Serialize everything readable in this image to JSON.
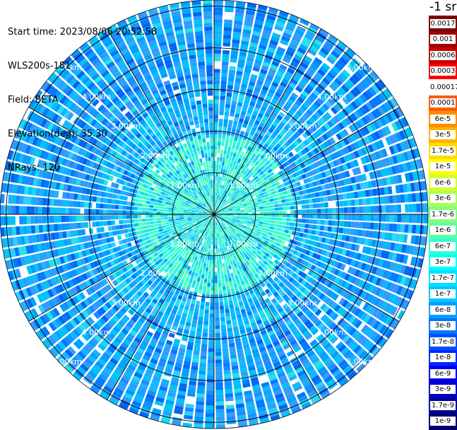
{
  "info": {
    "start_time": "Start time: 2023/08/06 20:52:58",
    "instrument": "WLS200s-181",
    "field": "Field: BETA",
    "elevation": "Elevation(deg): 35.30",
    "nrays": "NRays: 120"
  },
  "colorbar": {
    "title": "-1 sr",
    "labels": [
      "0.0017",
      "0.001",
      "0.0006",
      "0.0003",
      "0.00017",
      "0.0001",
      "6e-5",
      "3e-5",
      "1.7e-5",
      "1e-5",
      "6e-6",
      "3e-6",
      "1.7e-6",
      "1e-6",
      "6e-7",
      "3e-7",
      "1.7e-7",
      "1e-7",
      "6e-8",
      "3e-8",
      "1.7e-8",
      "1e-8",
      "6e-9",
      "3e-9",
      "1.7e-9",
      "1e-9"
    ],
    "colors": [
      "#800000",
      "#a00000",
      "#c80000",
      "#ff0000",
      "#ffffff",
      "#ff5a00",
      "#ff8c00",
      "#ffb400",
      "#ffdc00",
      "#ffff00",
      "#d2ff2d",
      "#aaff55",
      "#82ff7d",
      "#5affa5",
      "#32ffd2",
      "#00ffff",
      "#00e1ff",
      "#00c8ff",
      "#00a0ff",
      "#0078ff",
      "#0050ff",
      "#0028ff",
      "#0000f0",
      "#0000c8",
      "#00009c",
      "#000070"
    ]
  },
  "chart_data": {
    "type": "heatmap",
    "subtype": "polar-ppi",
    "field": "BETA",
    "units": "-1 sr",
    "n_rays": 120,
    "elevation_deg": 35.3,
    "range_rings_km": [
      1,
      2,
      3,
      4,
      5
    ],
    "range_ring_labels": [
      "1.00km",
      "2.00km",
      "3.00km",
      "4.00km",
      "5.00km"
    ],
    "max_range_km": 5.15,
    "azimuth_spokes_deg": [
      0,
      30,
      60,
      90,
      120,
      150,
      180,
      210,
      240,
      270,
      300,
      330
    ],
    "value_distribution": [
      {
        "range_km": [
          0.0,
          2.0
        ],
        "dominant_value": "1.7e-7 to 3e-7"
      },
      {
        "range_km": [
          2.0,
          3.0
        ],
        "dominant_value": "6e-8 to 1e-7"
      },
      {
        "range_km": [
          3.0,
          5.15
        ],
        "dominant_value": "3e-8 to 6e-8"
      }
    ]
  }
}
